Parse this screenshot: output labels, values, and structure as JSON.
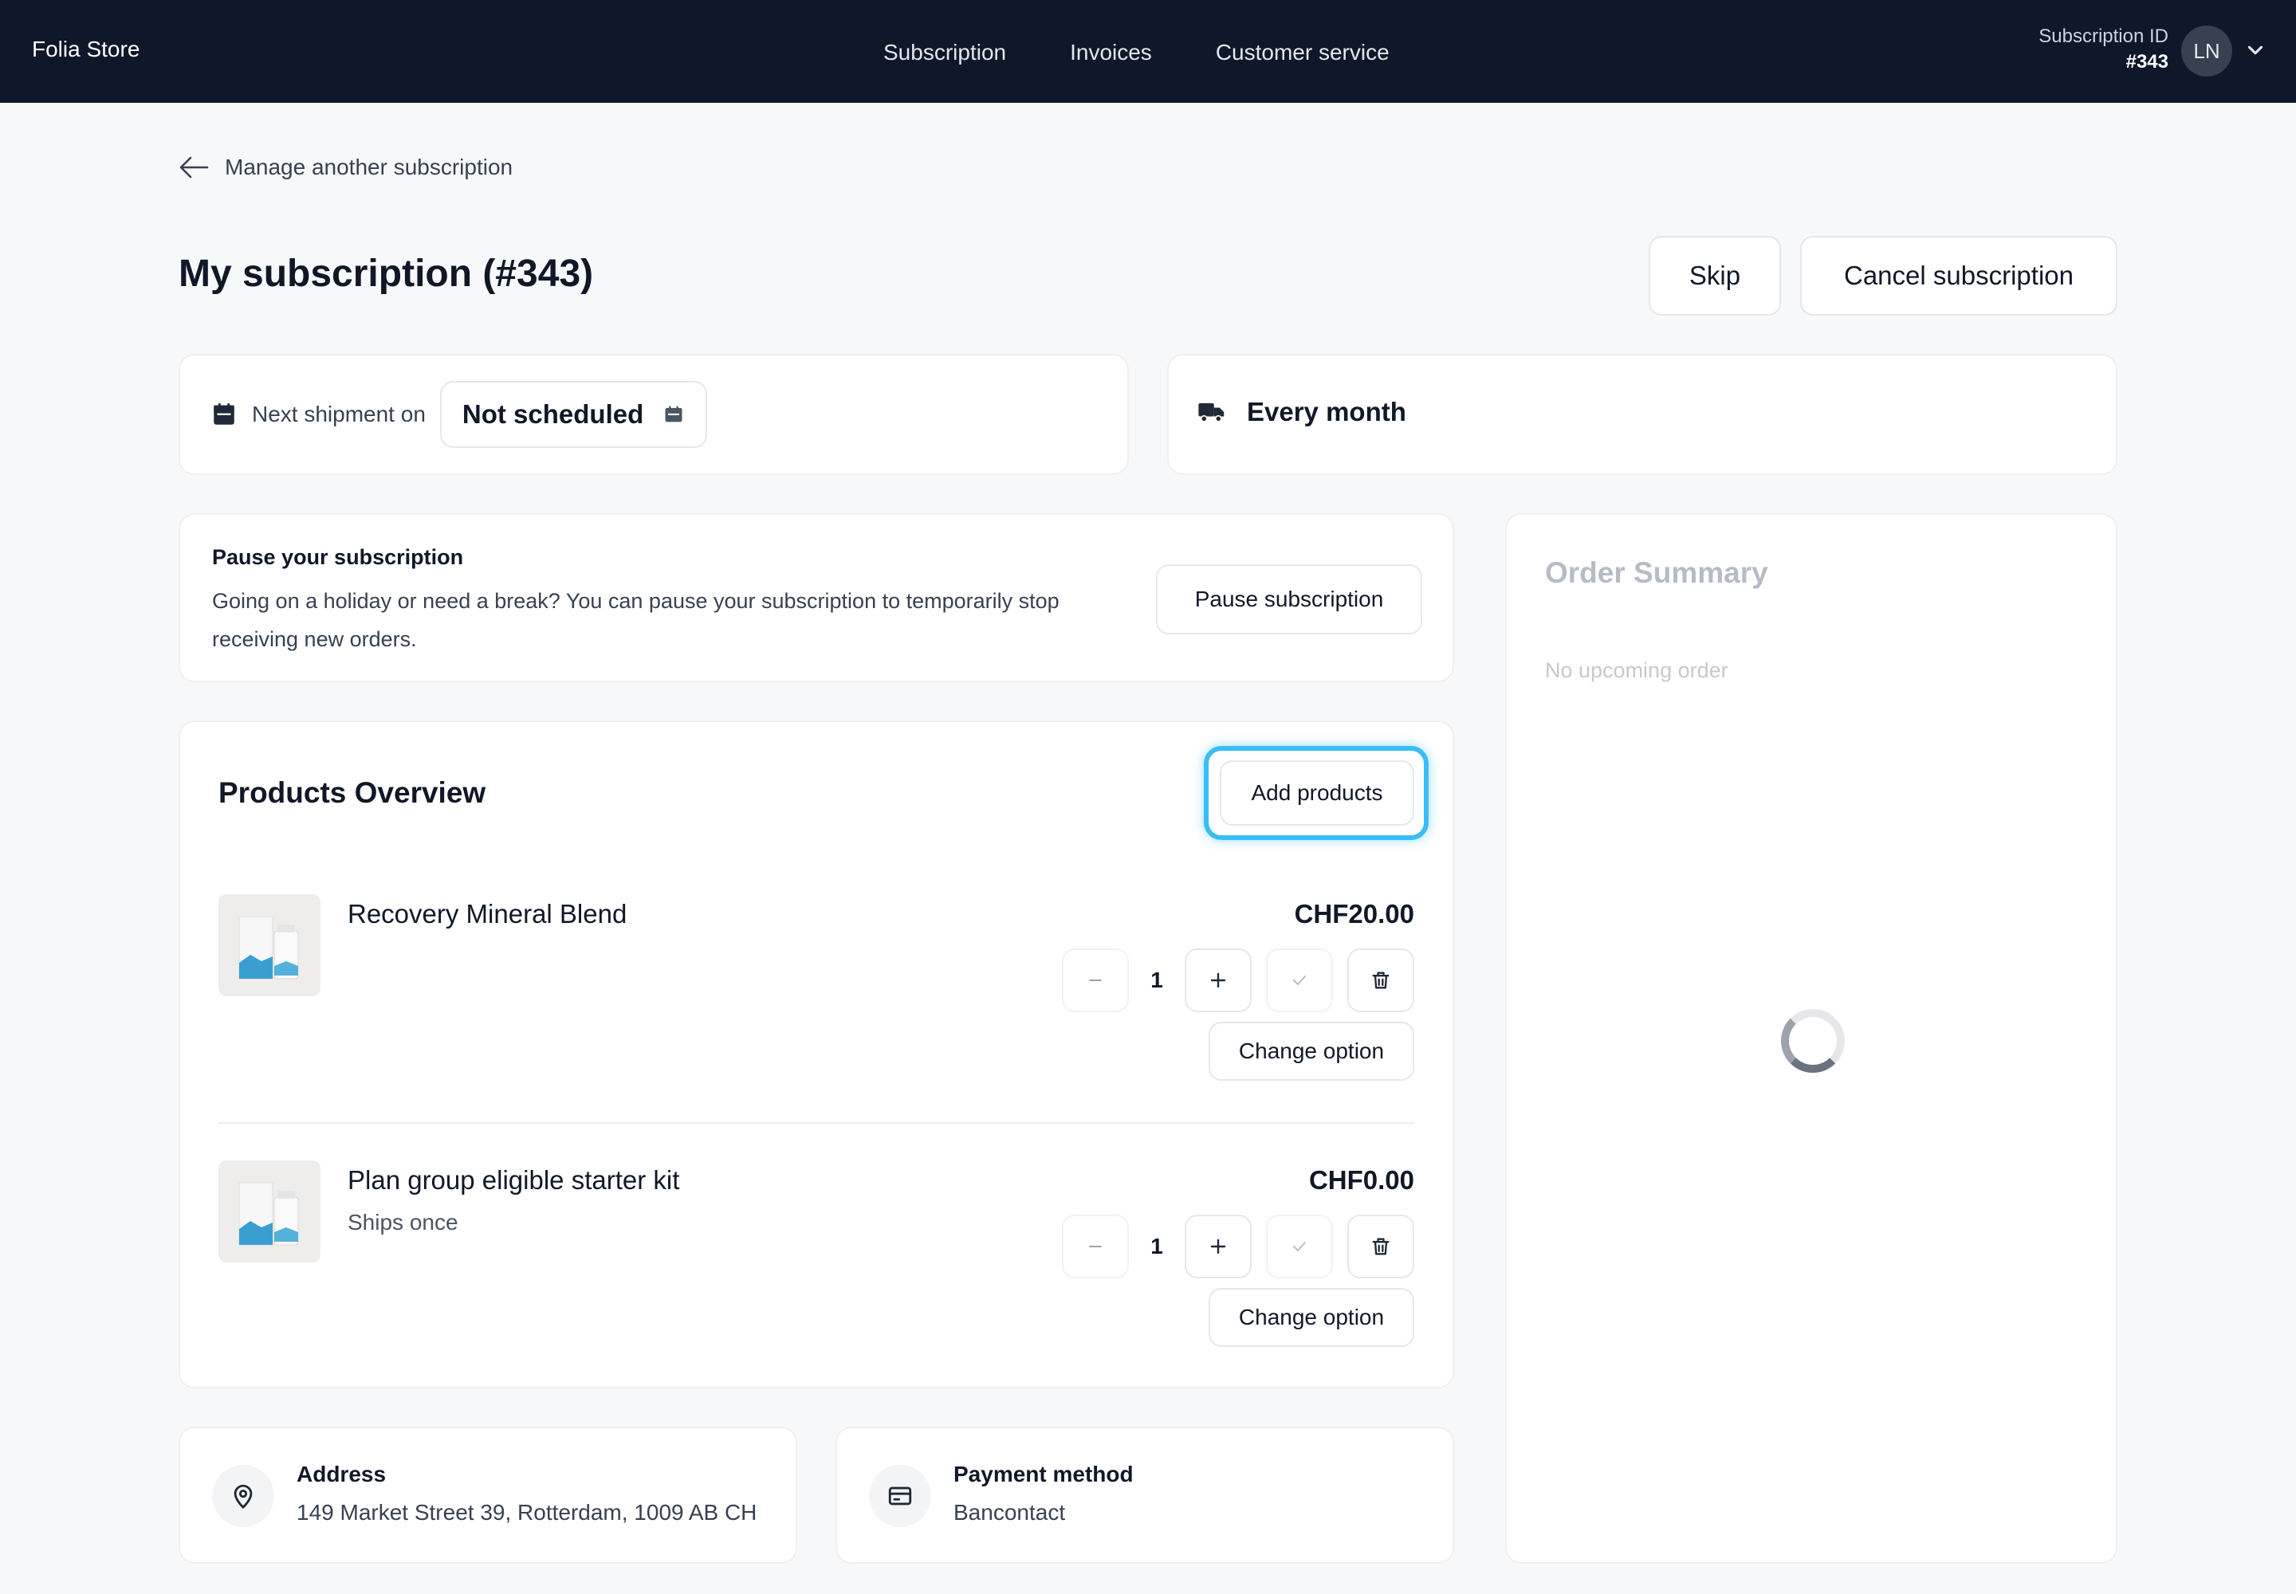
{
  "app": {
    "brand": "Folia Store"
  },
  "nav": {
    "items": [
      "Subscription",
      "Invoices",
      "Customer service"
    ]
  },
  "account": {
    "subscription_id_label": "Subscription ID",
    "subscription_id_value": "#343",
    "avatar_initials": "LN"
  },
  "back_link": "Manage another subscription",
  "page_title": "My subscription (#343)",
  "actions": {
    "skip": "Skip",
    "cancel": "Cancel subscription"
  },
  "shipment": {
    "label": "Next shipment on",
    "date": "Not scheduled"
  },
  "frequency": "Every month",
  "pause": {
    "title": "Pause your subscription",
    "text": "Going on a holiday or need a break? You can pause your subscription to temporarily stop receiving new orders.",
    "button": "Pause subscription"
  },
  "products": {
    "title": "Products Overview",
    "add_button": "Add products",
    "change_option_label": "Change option",
    "items": [
      {
        "name": "Recovery Mineral Blend",
        "subtitle": "",
        "price": "CHF20.00",
        "quantity": "1"
      },
      {
        "name": "Plan group eligible starter kit",
        "subtitle": "Ships once",
        "price": "CHF0.00",
        "quantity": "1"
      }
    ]
  },
  "address": {
    "title": "Address",
    "value": "149 Market Street 39, Rotterdam, 1009 AB CH"
  },
  "payment": {
    "title": "Payment method",
    "value": "Bancontact"
  },
  "summary": {
    "title": "Order Summary",
    "empty": "No upcoming order"
  },
  "colors": {
    "topbar": "#0f172a",
    "accent_focus": "#38bdf8",
    "text": "#101828"
  }
}
